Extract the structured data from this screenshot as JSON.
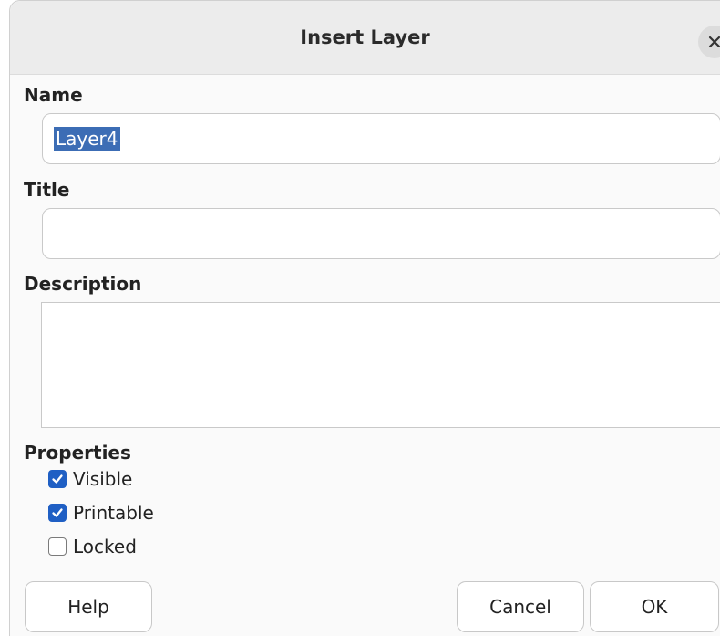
{
  "dialog": {
    "title": "Insert Layer",
    "close_icon": "close-icon"
  },
  "name": {
    "label": "Name",
    "value": "Layer4"
  },
  "title_field": {
    "label": "Title",
    "value": ""
  },
  "description": {
    "label": "Description",
    "value": ""
  },
  "properties": {
    "label": "Properties",
    "items": [
      {
        "label": "Visible",
        "checked": true
      },
      {
        "label": "Printable",
        "checked": true
      },
      {
        "label": "Locked",
        "checked": false
      }
    ]
  },
  "buttons": {
    "help": "Help",
    "cancel": "Cancel",
    "ok": "OK"
  },
  "colors": {
    "accent": "#1f5fc4",
    "selection": "#3c6db5"
  }
}
